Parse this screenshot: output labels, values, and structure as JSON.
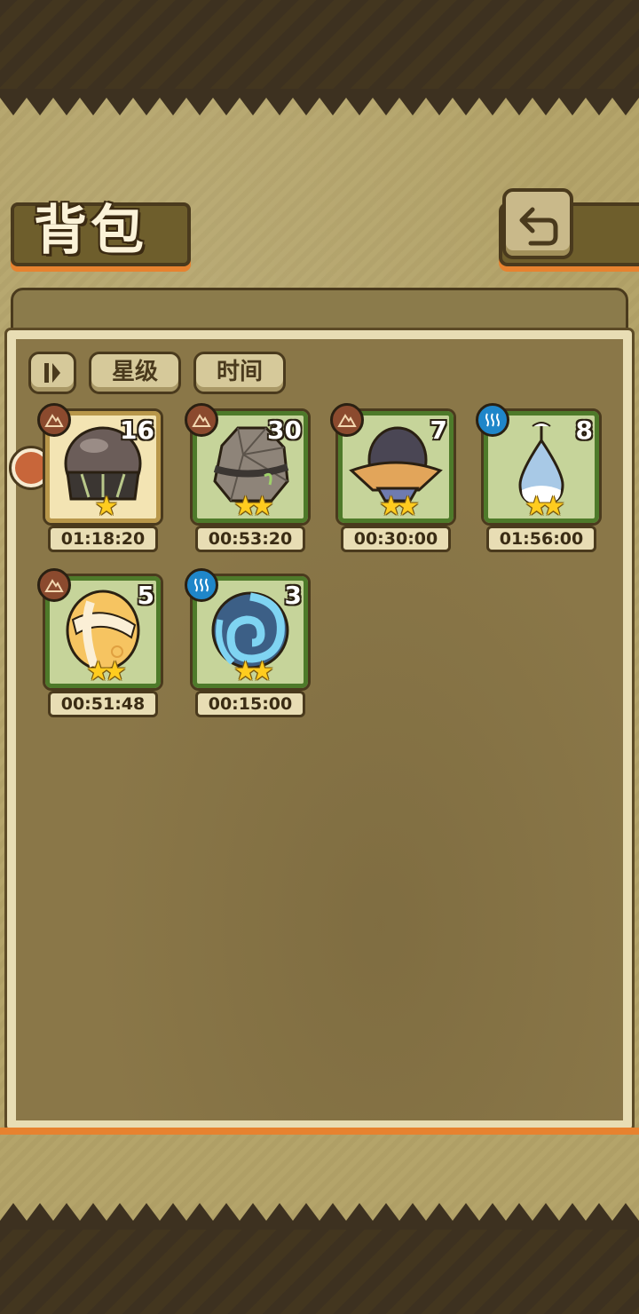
{
  "title": "背包",
  "filters": {
    "sort_icon": "pause-sort-icon",
    "star_label": "星级",
    "time_label": "时间"
  },
  "back_icon": "return-arrow-icon",
  "items": [
    {
      "count": "16",
      "stars": "★",
      "timer": "01:18:20",
      "element": "earth",
      "frame": "gold",
      "icon": "steel-cage-egg-icon"
    },
    {
      "count": "30",
      "stars": "★★",
      "timer": "00:53:20",
      "element": "earth",
      "frame": "green",
      "icon": "stone-egg-icon"
    },
    {
      "count": "7",
      "stars": "★★",
      "timer": "00:30:00",
      "element": "earth",
      "frame": "green",
      "icon": "hat-egg-icon"
    },
    {
      "count": "8",
      "stars": "★★",
      "timer": "01:56:00",
      "element": "water",
      "frame": "green",
      "icon": "water-drop-egg-icon"
    },
    {
      "count": "5",
      "stars": "★★",
      "timer": "00:51:48",
      "element": "earth",
      "frame": "green",
      "icon": "cloud-pattern-egg-icon"
    },
    {
      "count": "3",
      "stars": "★★",
      "timer": "00:15:00",
      "element": "water",
      "frame": "green",
      "icon": "shell-egg-icon"
    }
  ],
  "colors": {
    "accent_orange": "#e7822f",
    "frame_green": "#4e7a2a",
    "frame_gold": "#b8974a",
    "earth_badge": "#8b4a2e",
    "water_badge": "#1f86c9"
  }
}
